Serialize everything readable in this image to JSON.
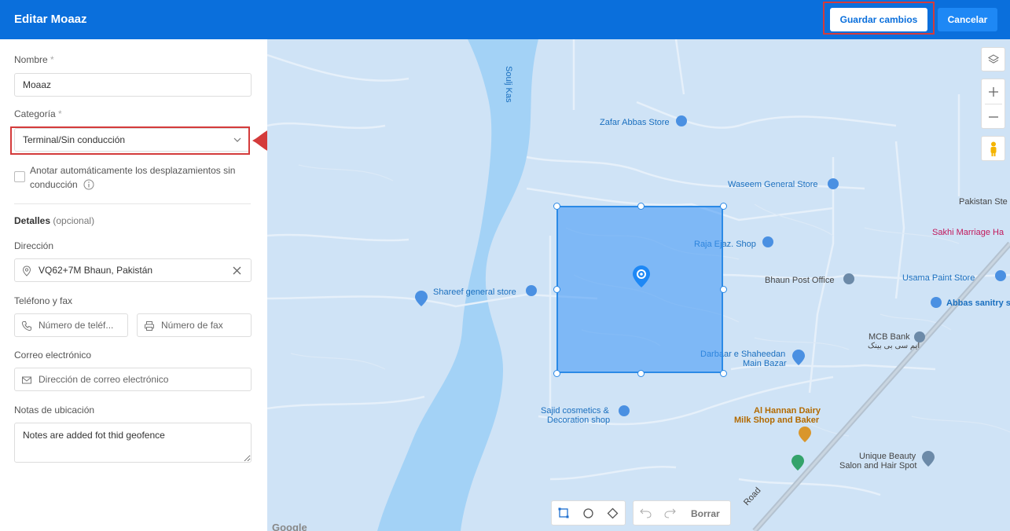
{
  "header": {
    "title": "Editar Moaaz",
    "save_label": "Guardar cambios",
    "cancel_label": "Cancelar",
    "save_callout": "5"
  },
  "form": {
    "name_label": "Nombre",
    "name_required": "*",
    "name_value": "Moaaz",
    "category_label": "Categoría",
    "category_required": "*",
    "category_value": "Terminal/Sin conducción",
    "category_callout": "4",
    "auto_annotate_label": "Anotar automáticamente los desplazamientos sin conducción",
    "details_label": "Detalles",
    "details_optional": "(opcional)",
    "address_label": "Dirección",
    "address_value": "VQ62+7M Bhaun, Pakistán",
    "phone_fax_label": "Teléfono y fax",
    "phone_placeholder": "Número de teléf...",
    "fax_placeholder": "Número de fax",
    "email_label": "Correo electrónico",
    "email_placeholder": "Dirección de correo electrónico",
    "notes_label": "Notas de ubicación",
    "notes_value": "Notes are added fot thid geofence"
  },
  "map": {
    "river_label": "Soulj Kas",
    "pois": {
      "zafar": "Zafar Abbas Store",
      "waseem": "Waseem General Store",
      "pakistan": "Pakistan Ste",
      "sakhi": "Sakhi Marriage Ha",
      "raja": "Raja Ejaz. Shop",
      "post": "Bhaun Post Office",
      "usama": "Usama Paint Store",
      "shareef": "Shareef general store",
      "abbas": "Abbas sanitry s",
      "mcb": "MCB Bank",
      "mcb_urdu": "ایم سی بی بینک",
      "darbaar_1": "Darbaar e Shaheedan",
      "darbaar_2": "Main Bazar",
      "sajid_1": "Sajid cosmetics &",
      "sajid_2": "Decoration shop",
      "hannan_1": "Al Hannan Dairy",
      "hannan_2": "Milk Shop and Baker",
      "unique_1": "Unique Beauty",
      "unique_2": "Salon and Hair Spot",
      "road": "Road",
      "google": "Google"
    },
    "erase_label": "Borrar"
  }
}
